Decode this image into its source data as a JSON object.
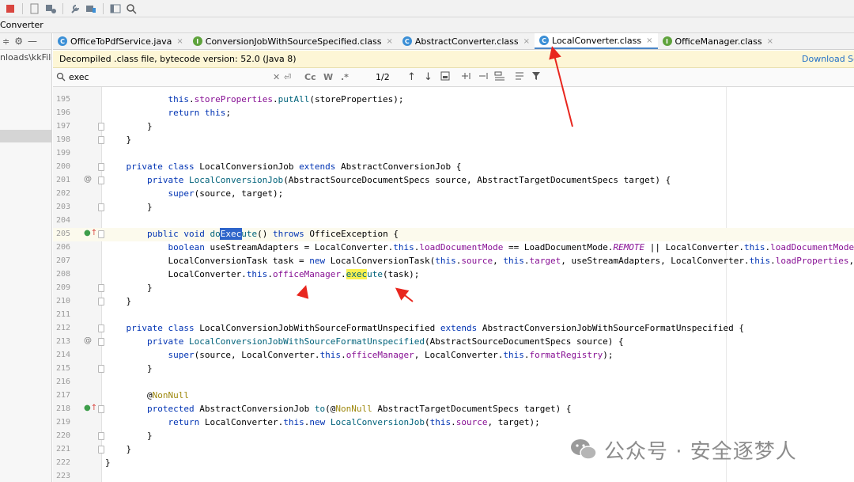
{
  "toolbar": {
    "icons": [
      "stop-icon",
      "export-icon",
      "run-config-icon",
      "wrench-icon",
      "project-structure-icon",
      "layout-icon",
      "search-icon"
    ]
  },
  "breadcrumb": {
    "label": "Converter"
  },
  "project_panel": {
    "path_text": "nloads\\kkFileV"
  },
  "tabs": [
    {
      "label": "OfficeToPdfService.java",
      "icon": "C",
      "icon_color": "#3b8fd6",
      "active": false
    },
    {
      "label": "ConversionJobWithSourceSpecified.class",
      "icon": "I",
      "icon_color": "#5fa33c",
      "active": false
    },
    {
      "label": "AbstractConverter.class",
      "icon": "C",
      "icon_color": "#3b8fd6",
      "active": false
    },
    {
      "label": "LocalConverter.class",
      "icon": "C",
      "icon_color": "#3b8fd6",
      "active": true
    },
    {
      "label": "OfficeManager.class",
      "icon": "I",
      "icon_color": "#5fa33c",
      "active": false
    }
  ],
  "banner": {
    "text": "Decompiled .class file, bytecode version: 52.0 (Java 8)",
    "link": "Download Sou"
  },
  "search": {
    "query": "exec",
    "match_count": "1/2",
    "toggles": [
      "Cc",
      "W",
      ".*"
    ]
  },
  "editor": {
    "current_line": 205,
    "lines": [
      {
        "num": "195",
        "fold": false,
        "mark": "",
        "code": "            this.storeProperties.putAll(storeProperties);"
      },
      {
        "num": "196",
        "fold": false,
        "mark": "",
        "code": "            return this;"
      },
      {
        "num": "197",
        "fold": true,
        "mark": "",
        "code": "        }"
      },
      {
        "num": "198",
        "fold": true,
        "mark": "",
        "code": "    }"
      },
      {
        "num": "199",
        "fold": false,
        "mark": "",
        "code": ""
      },
      {
        "num": "200",
        "fold": true,
        "mark": "",
        "code": "    private class LocalConversionJob extends AbstractConversionJob {"
      },
      {
        "num": "201",
        "fold": true,
        "mark": "@",
        "code": "        private LocalConversionJob(AbstractSourceDocumentSpecs source, AbstractTargetDocumentSpecs target) {"
      },
      {
        "num": "202",
        "fold": false,
        "mark": "",
        "code": "            super(source, target);"
      },
      {
        "num": "203",
        "fold": true,
        "mark": "",
        "code": "        }"
      },
      {
        "num": "204",
        "fold": false,
        "mark": "",
        "code": ""
      },
      {
        "num": "205",
        "fold": true,
        "mark": "o↑",
        "code": "        public void doExecute() throws OfficeException {"
      },
      {
        "num": "206",
        "fold": false,
        "mark": "",
        "code": "            boolean useStreamAdapters = LocalConverter.this.loadDocumentMode == LoadDocumentMode.REMOTE || LocalConverter.this.loadDocumentMode ="
      },
      {
        "num": "207",
        "fold": false,
        "mark": "",
        "code": "            LocalConversionTask task = new LocalConversionTask(this.source, this.target, useStreamAdapters, LocalConverter.this.loadProperties, L"
      },
      {
        "num": "208",
        "fold": false,
        "mark": "",
        "code": "            LocalConverter.this.officeManager.execute(task);"
      },
      {
        "num": "209",
        "fold": true,
        "mark": "",
        "code": "        }"
      },
      {
        "num": "210",
        "fold": true,
        "mark": "",
        "code": "    }"
      },
      {
        "num": "211",
        "fold": false,
        "mark": "",
        "code": ""
      },
      {
        "num": "212",
        "fold": true,
        "mark": "",
        "code": "    private class LocalConversionJobWithSourceFormatUnspecified extends AbstractConversionJobWithSourceFormatUnspecified {"
      },
      {
        "num": "213",
        "fold": true,
        "mark": "@",
        "code": "        private LocalConversionJobWithSourceFormatUnspecified(AbstractSourceDocumentSpecs source) {"
      },
      {
        "num": "214",
        "fold": false,
        "mark": "",
        "code": "            super(source, LocalConverter.this.officeManager, LocalConverter.this.formatRegistry);"
      },
      {
        "num": "215",
        "fold": true,
        "mark": "",
        "code": "        }"
      },
      {
        "num": "216",
        "fold": false,
        "mark": "",
        "code": ""
      },
      {
        "num": "217",
        "fold": false,
        "mark": "",
        "code": "        @NonNull"
      },
      {
        "num": "218",
        "fold": true,
        "mark": "o↑",
        "code": "        protected AbstractConversionJob to(@NonNull AbstractTargetDocumentSpecs target) {"
      },
      {
        "num": "219",
        "fold": false,
        "mark": "",
        "code": "            return LocalConverter.this.new LocalConversionJob(this.source, target);"
      },
      {
        "num": "220",
        "fold": true,
        "mark": "",
        "code": "        }"
      },
      {
        "num": "221",
        "fold": true,
        "mark": "",
        "code": "    }"
      },
      {
        "num": "222",
        "fold": false,
        "mark": "",
        "code": "}"
      },
      {
        "num": "223",
        "fold": false,
        "mark": "",
        "code": ""
      }
    ]
  },
  "watermark": {
    "text": "公众号 · 安全逐梦人"
  },
  "colors": {
    "keyword": "#0033b3",
    "field": "#871094",
    "method": "#00627a",
    "search_highlight": "#f9f14e",
    "current_match": "#2f65ca",
    "annotation_arrow": "#e8261e",
    "active_tab_underline": "#4a86c8"
  }
}
